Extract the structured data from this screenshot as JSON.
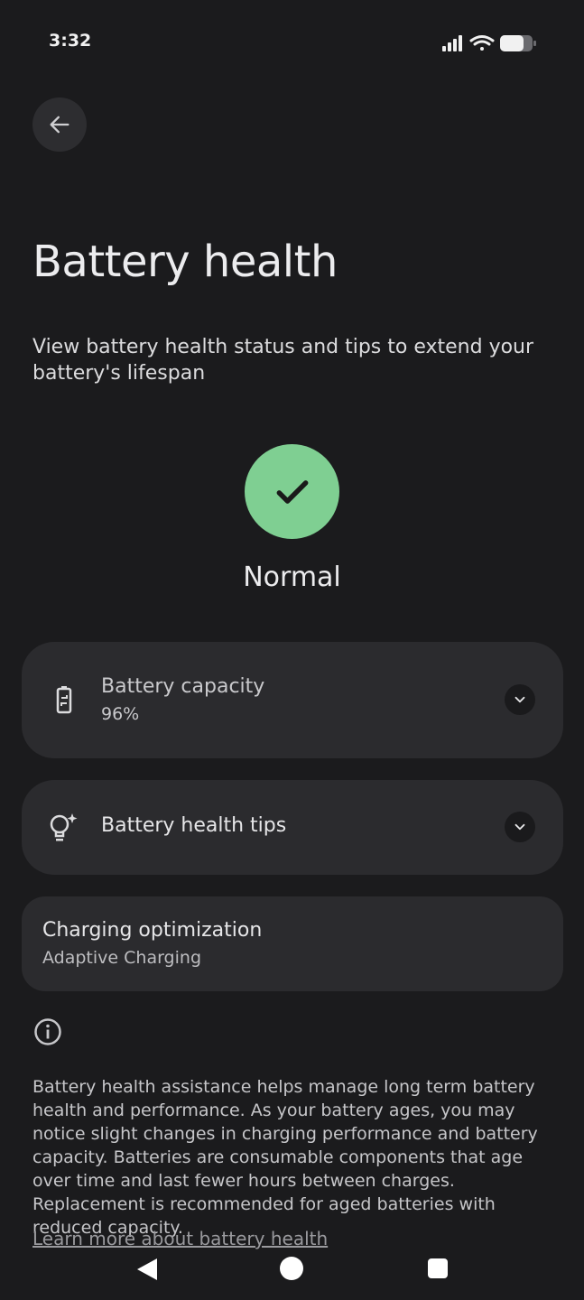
{
  "status_bar": {
    "time": "3:32",
    "icons": [
      "signal-icon",
      "wifi-icon",
      "battery-icon"
    ]
  },
  "header": {
    "back_icon": "arrow-left-icon",
    "title": "Battery health",
    "subtitle": "View battery health status and tips to extend your battery's lifespan"
  },
  "health_status": {
    "icon": "check-icon",
    "label": "Normal",
    "color": "#7fcf92"
  },
  "cards": {
    "capacity": {
      "icon": "battery-sync-icon",
      "title": "Battery capacity",
      "value": "96%",
      "expand_icon": "chevron-down-icon"
    },
    "tips": {
      "icon": "lightbulb-sparkle-icon",
      "title": "Battery health tips",
      "expand_icon": "chevron-down-icon"
    },
    "charging": {
      "title": "Charging optimization",
      "value": "Adaptive Charging"
    }
  },
  "info": {
    "icon": "info-icon",
    "description": "Battery health assistance helps manage long term battery health and performance. As your battery ages, you may notice slight changes in charging performance and battery capacity. Batteries are consumable components that age over time and last fewer hours between charges. Replacement is recommended for aged batteries with reduced capacity.",
    "link": "Learn more about battery health"
  },
  "nav_bar": {
    "icons": [
      "nav-back-icon",
      "nav-home-icon",
      "nav-recents-icon"
    ]
  }
}
